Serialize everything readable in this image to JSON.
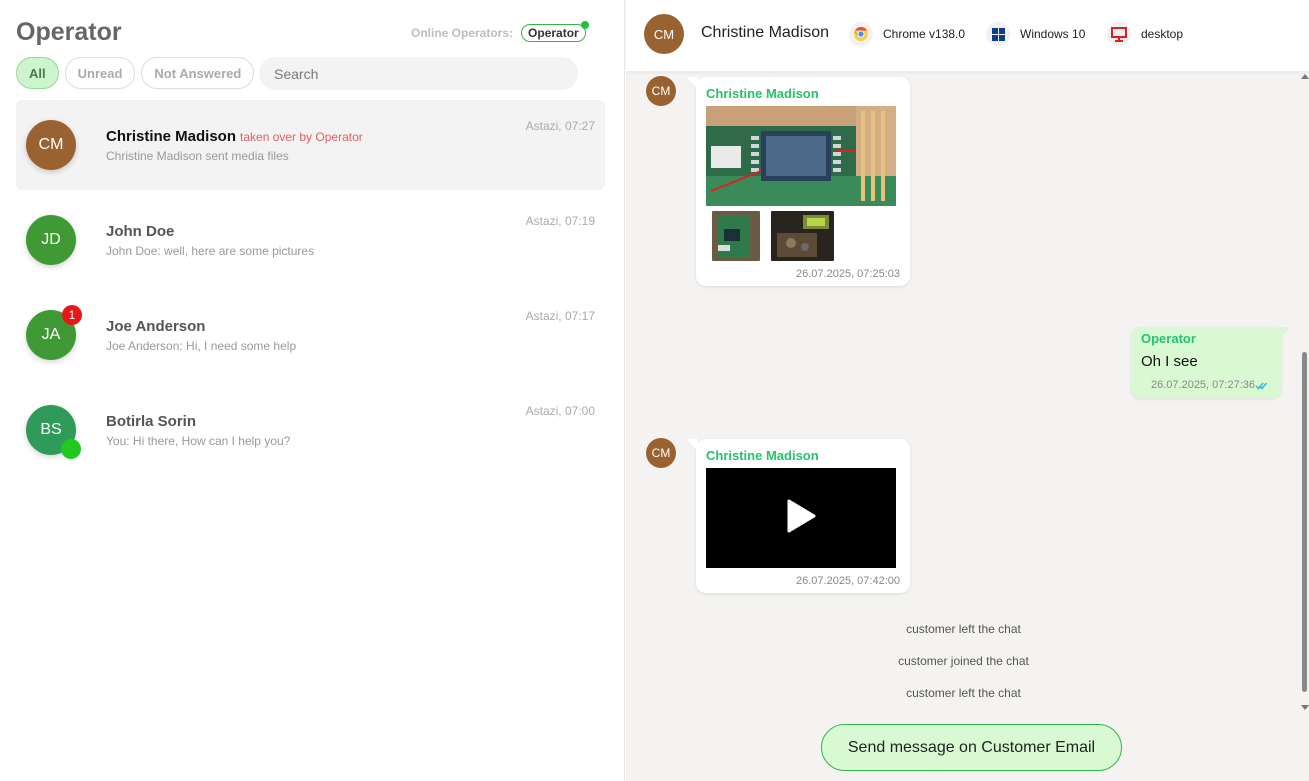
{
  "sidebar": {
    "title": "Operator",
    "online_label": "Online Operators:",
    "online_operator": "Operator",
    "filters": [
      "All",
      "Unread",
      "Not Answered"
    ],
    "active_filter": "All",
    "search_placeholder": "Search"
  },
  "conversations": [
    {
      "initials": "CM",
      "name": "Christine Madison",
      "status_note": "taken over by Operator",
      "preview": "Christine Madison sent media files",
      "time": "Astazi, 07:27",
      "avatar_color": "#9a6230",
      "selected": true
    },
    {
      "initials": "JD",
      "name": "John Doe",
      "preview": "John Doe: well, here are some pictures",
      "time": "Astazi, 07:19",
      "avatar_color": "#3f9a35"
    },
    {
      "initials": "JA",
      "name": "Joe Anderson",
      "preview": "Joe Anderson: Hi, I need some help",
      "time": "Astazi, 07:17",
      "avatar_color": "#3f9a35",
      "unread_count": "1"
    },
    {
      "initials": "BS",
      "name": "Botirla Sorin",
      "preview": "You: Hi there, How can I help you?",
      "time": "Astazi, 07:00",
      "avatar_color": "#2f9b5a",
      "online": true
    }
  ],
  "chat": {
    "header": {
      "initials": "CM",
      "name": "Christine Madison",
      "browser": "Chrome v138.0",
      "browser_icon": "chrome-icon",
      "os": "Windows 10",
      "os_icon": "windows-icon",
      "device": "desktop",
      "device_icon": "desktop-monitor-icon"
    },
    "messages": [
      {
        "type": "images",
        "sender": "Christine Madison",
        "initials": "CM",
        "timestamp": "26.07.2025, 07:25:03"
      },
      {
        "type": "text",
        "sender": "Operator",
        "text": "Oh I see",
        "timestamp": "26.07.2025, 07:27:36",
        "status_icon": "double-check-icon"
      },
      {
        "type": "video",
        "sender": "Christine Madison",
        "initials": "CM",
        "timestamp": "26.07.2025, 07:42:00"
      }
    ],
    "system_events": [
      "customer left the chat",
      "customer joined the chat",
      "customer left the chat"
    ],
    "email_button": "Send message on Customer Email"
  },
  "colors": {
    "accent_green": "#27c26b",
    "active_chip": "#cdf5cd",
    "outgoing_bubble": "#d9f9d3",
    "unread_badge": "#e61818",
    "taken_over_text": "#e06060"
  }
}
